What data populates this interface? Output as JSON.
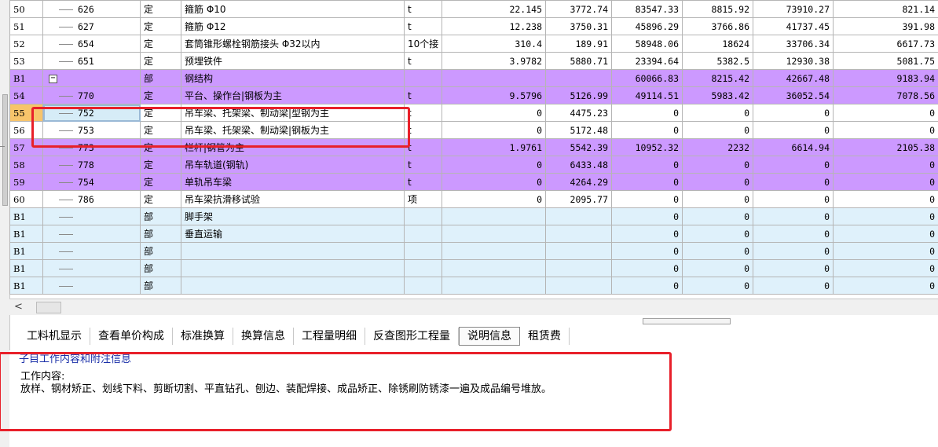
{
  "rows": [
    {
      "type": "white",
      "no": "50",
      "code": "626",
      "kind": "定",
      "name": "箍筋 Φ10",
      "unit": "t",
      "qty": "22.145",
      "price": "3772.74",
      "total": "83547.33",
      "c1": "8815.92",
      "c2": "73910.27",
      "c3": "821.14"
    },
    {
      "type": "white",
      "no": "51",
      "code": "627",
      "kind": "定",
      "name": "箍筋 Φ12",
      "unit": "t",
      "qty": "12.238",
      "price": "3750.31",
      "total": "45896.29",
      "c1": "3766.86",
      "c2": "41737.45",
      "c3": "391.98"
    },
    {
      "type": "white",
      "no": "52",
      "code": "654",
      "kind": "定",
      "name": "套筒锥形螺栓钢筋接头 Φ32以内",
      "unit": "10个接",
      "qty": "310.4",
      "price": "189.91",
      "total": "58948.06",
      "c1": "18624",
      "c2": "33706.34",
      "c3": "6617.73"
    },
    {
      "type": "white",
      "no": "53",
      "code": "651",
      "kind": "定",
      "name": "预埋铁件",
      "unit": "t",
      "qty": "3.9782",
      "price": "5880.71",
      "total": "23394.64",
      "c1": "5382.5",
      "c2": "12930.38",
      "c3": "5081.75"
    },
    {
      "type": "purple",
      "no": "B1",
      "code": "",
      "kind": "部",
      "name": "钢结构",
      "unit": "",
      "qty": "",
      "price": "",
      "total": "60066.83",
      "c1": "8215.42",
      "c2": "42667.48",
      "c3": "9183.94",
      "expander": "−"
    },
    {
      "type": "purple",
      "no": "54",
      "code": "770",
      "kind": "定",
      "name": "平台、操作台|钢板为主",
      "unit": "t",
      "qty": "9.5796",
      "price": "5126.99",
      "total": "49114.51",
      "c1": "5983.42",
      "c2": "36052.54",
      "c3": "7078.56"
    },
    {
      "type": "white",
      "no": "55",
      "code": "752",
      "kind": "定",
      "name": "吊车梁、托架梁、制动梁|型钢为主",
      "unit": "t",
      "qty": "0",
      "price": "4475.23",
      "total": "0",
      "c1": "0",
      "c2": "0",
      "c3": "0",
      "selected": true
    },
    {
      "type": "white",
      "no": "56",
      "code": "753",
      "kind": "定",
      "name": "吊车梁、托架梁、制动梁|钢板为主",
      "unit": "t",
      "qty": "0",
      "price": "5172.48",
      "total": "0",
      "c1": "0",
      "c2": "0",
      "c3": "0"
    },
    {
      "type": "purple",
      "no": "57",
      "code": "773",
      "kind": "定",
      "name": "栏杆|钢管为主",
      "unit": "t",
      "qty": "1.9761",
      "price": "5542.39",
      "total": "10952.32",
      "c1": "2232",
      "c2": "6614.94",
      "c3": "2105.38"
    },
    {
      "type": "purple",
      "no": "58",
      "code": "778",
      "kind": "定",
      "name": "吊车轨道(钢轨)",
      "unit": "t",
      "qty": "0",
      "price": "6433.48",
      "total": "0",
      "c1": "0",
      "c2": "0",
      "c3": "0"
    },
    {
      "type": "purple",
      "no": "59",
      "code": "754",
      "kind": "定",
      "name": "单轨吊车梁",
      "unit": "t",
      "qty": "0",
      "price": "4264.29",
      "total": "0",
      "c1": "0",
      "c2": "0",
      "c3": "0"
    },
    {
      "type": "white",
      "no": "60",
      "code": "786",
      "kind": "定",
      "name": "吊车梁抗滑移试验",
      "unit": "项",
      "qty": "0",
      "price": "2095.77",
      "total": "0",
      "c1": "0",
      "c2": "0",
      "c3": "0"
    },
    {
      "type": "blue",
      "no": "B1",
      "code": "",
      "kind": "部",
      "name": "脚手架",
      "unit": "",
      "qty": "",
      "price": "",
      "total": "0",
      "c1": "0",
      "c2": "0",
      "c3": "0"
    },
    {
      "type": "blue",
      "no": "B1",
      "code": "",
      "kind": "部",
      "name": "垂直运输",
      "unit": "",
      "qty": "",
      "price": "",
      "total": "0",
      "c1": "0",
      "c2": "0",
      "c3": "0"
    },
    {
      "type": "blue",
      "no": "B1",
      "code": "",
      "kind": "部",
      "name": "",
      "unit": "",
      "qty": "",
      "price": "",
      "total": "0",
      "c1": "0",
      "c2": "0",
      "c3": "0"
    },
    {
      "type": "blue",
      "no": "B1",
      "code": "",
      "kind": "部",
      "name": "",
      "unit": "",
      "qty": "",
      "price": "",
      "total": "0",
      "c1": "0",
      "c2": "0",
      "c3": "0"
    },
    {
      "type": "blue",
      "no": "B1",
      "code": "",
      "kind": "部",
      "name": "",
      "unit": "",
      "qty": "",
      "price": "",
      "total": "0",
      "c1": "0",
      "c2": "0",
      "c3": "0"
    }
  ],
  "tabs": [
    "工料机显示",
    "查看单价构成",
    "标准换算",
    "换算信息",
    "工程量明细",
    "反查图形工程量",
    "说明信息",
    "租赁费"
  ],
  "active_tab": 6,
  "info": {
    "header": "子目工作内容和附注信息",
    "label": "工作内容:",
    "content": "放样、钢材矫正、划线下料、剪断切割、平直钻孔、刨边、装配焊接、成品矫正、除锈刷防锈漆一遍及成品编号堆放。"
  },
  "colors": {
    "purple": "#cc99ff",
    "blue": "#dff1fb",
    "highlight": "#e8202a",
    "selected_rownum": "#f7c46b"
  },
  "icons": {
    "scroll_left": "chevron-left-icon",
    "expander": "collapse-icon"
  }
}
